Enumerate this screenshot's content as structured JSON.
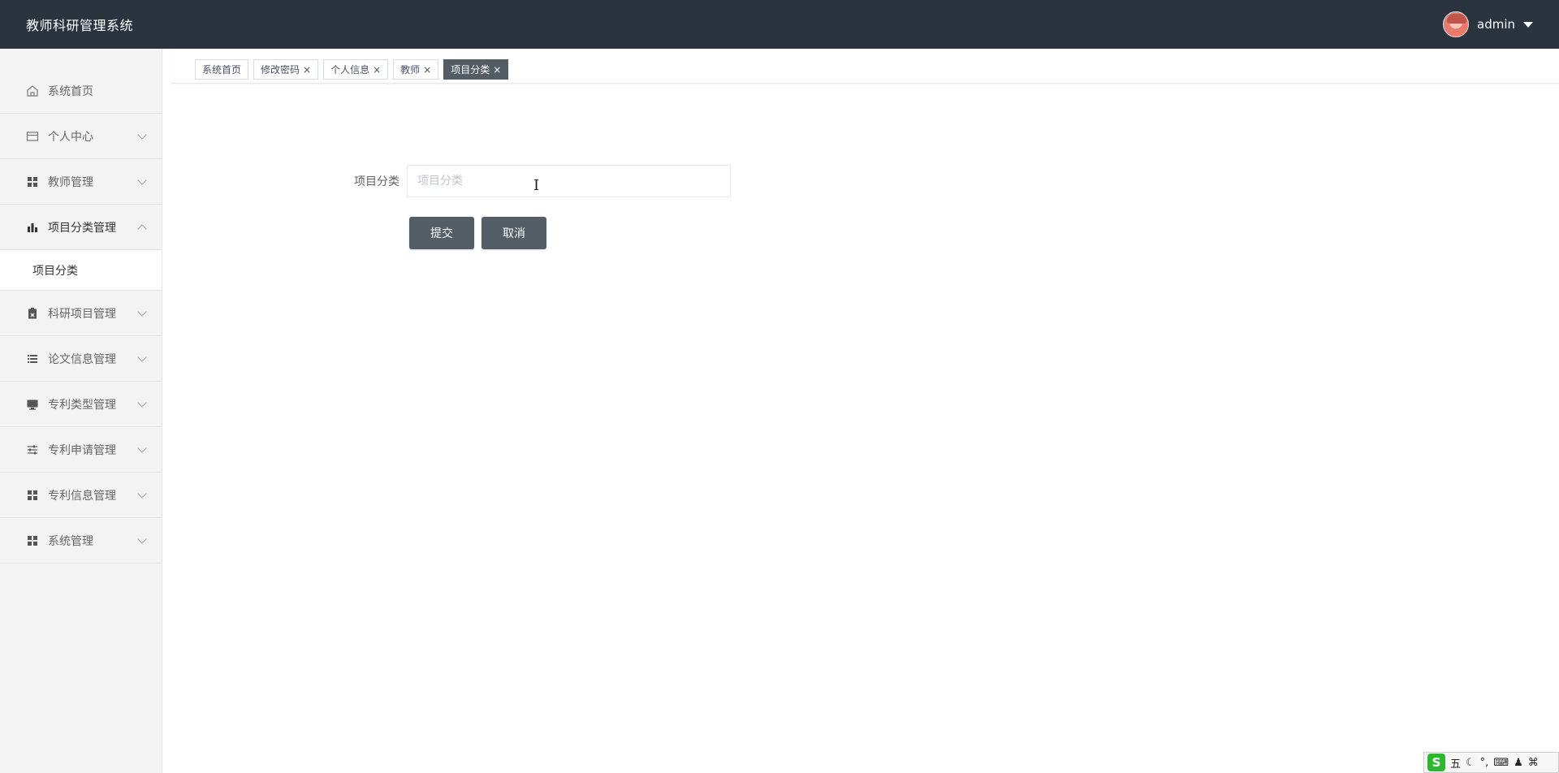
{
  "header": {
    "app_title": "教师科研管理系统",
    "user_name": "admin"
  },
  "sidebar": {
    "items": [
      {
        "label": "系统首页",
        "icon": "home-icon"
      },
      {
        "label": "个人中心",
        "icon": "card-icon"
      },
      {
        "label": "教师管理",
        "icon": "grid-icon"
      },
      {
        "label": "项目分类管理",
        "icon": "bar-chart-icon",
        "expanded": true
      },
      {
        "label": "科研项目管理",
        "icon": "clipboard-icon"
      },
      {
        "label": "论文信息管理",
        "icon": "list-icon"
      },
      {
        "label": "专利类型管理",
        "icon": "monitor-icon"
      },
      {
        "label": "专利申请管理",
        "icon": "sliders-icon"
      },
      {
        "label": "专利信息管理",
        "icon": "grid-icon"
      },
      {
        "label": "系统管理",
        "icon": "grid-icon"
      }
    ],
    "submenu": {
      "label": "项目分类"
    }
  },
  "tabs": [
    {
      "label": "系统首页",
      "closable": false
    },
    {
      "label": "修改密码",
      "closable": true
    },
    {
      "label": "个人信息",
      "closable": true
    },
    {
      "label": "教师",
      "closable": true
    },
    {
      "label": "项目分类",
      "closable": true,
      "active": true
    }
  ],
  "tab_close_glyph": "×",
  "form": {
    "field_label": "项目分类",
    "field_placeholder": "项目分类",
    "field_value": "",
    "submit_label": "提交",
    "cancel_label": "取消"
  },
  "ime": {
    "mode": "五"
  },
  "colors": {
    "header_bg": "#2b333e",
    "sidebar_bg": "#f3f3f3",
    "active_tab": "#545c64",
    "button_bg": "#555d66"
  }
}
